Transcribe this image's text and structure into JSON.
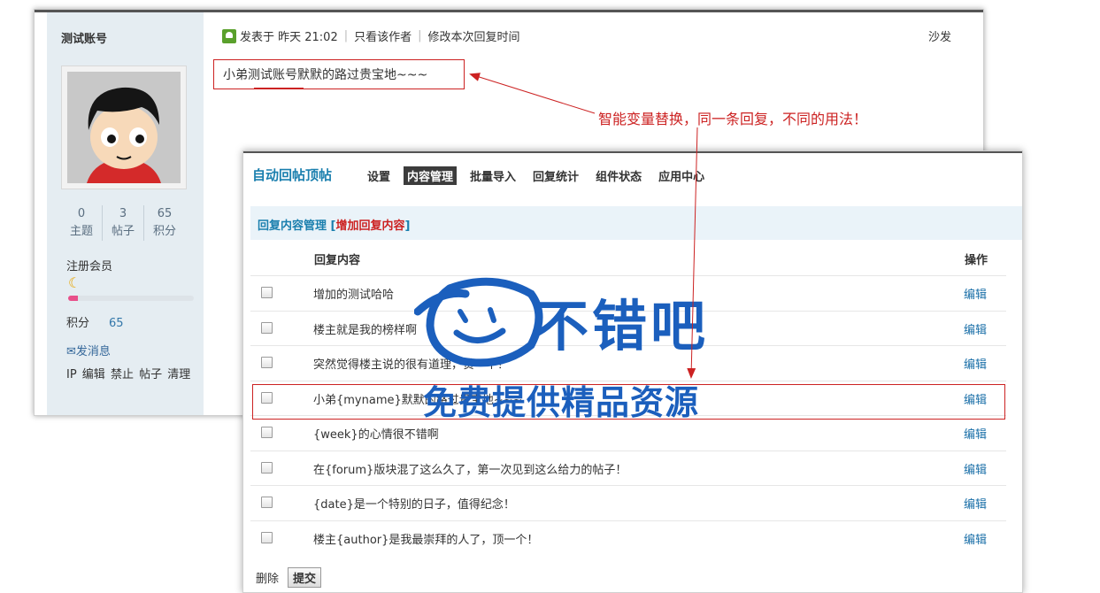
{
  "post": {
    "username": "测试账号",
    "stats": [
      {
        "value": "0",
        "label": "主题"
      },
      {
        "value": "3",
        "label": "帖子"
      },
      {
        "value": "65",
        "label": "积分"
      }
    ],
    "group": "注册会员",
    "points_label": "积分",
    "points_value": "65",
    "send_message": "发消息",
    "admin_links": "IP 编辑 禁止 帖子 清理",
    "posted_at": "发表于 昨天 21:02",
    "only_author": "只看该作者",
    "edit_time": "修改本次回复时间",
    "floor": "沙发",
    "content": "小弟测试账号默默的路过贵宝地~~~"
  },
  "annotation": "智能变量替换，同一条回复，不同的用法！",
  "panel": {
    "title": "自动回帖顶帖",
    "tabs": [
      "设置",
      "内容管理",
      "批量导入",
      "回复统计",
      "组件状态",
      "应用中心"
    ],
    "active_tab": 1,
    "section_title": "回复内容管理",
    "bracket_open": "[",
    "add_link": "增加回复内容",
    "bracket_close": "]",
    "col_content": "回复内容",
    "col_action": "操作",
    "rows": [
      {
        "text": "增加的测试哈哈",
        "action": "编辑"
      },
      {
        "text": "楼主就是我的榜样啊",
        "action": "编辑"
      },
      {
        "text": "突然觉得楼主说的很有道理，赞一个！",
        "action": "编辑"
      },
      {
        "text": "小弟{myname}默默的路过贵宝地~~~",
        "action": "编辑"
      },
      {
        "text": "{week}的心情很不错啊",
        "action": "编辑"
      },
      {
        "text": "在{forum}版块混了这么久了，第一次见到这么给力的帖子！",
        "action": "编辑"
      },
      {
        "text": "{date}是一个特别的日子，值得纪念！",
        "action": "编辑"
      },
      {
        "text": "楼主{author}是我最崇拜的人了，顶一个！",
        "action": "编辑"
      }
    ],
    "delete_label": "删除",
    "submit_label": "提交"
  },
  "watermark": {
    "line1": "不错吧",
    "line2": "免费提供精品资源"
  },
  "colors": {
    "accent": "#1a7fae",
    "annotation_red": "#cc2222",
    "sidebar_bg": "#e5edf2",
    "watermark_blue": "#1b5fbd"
  },
  "level_progress": 0.08
}
